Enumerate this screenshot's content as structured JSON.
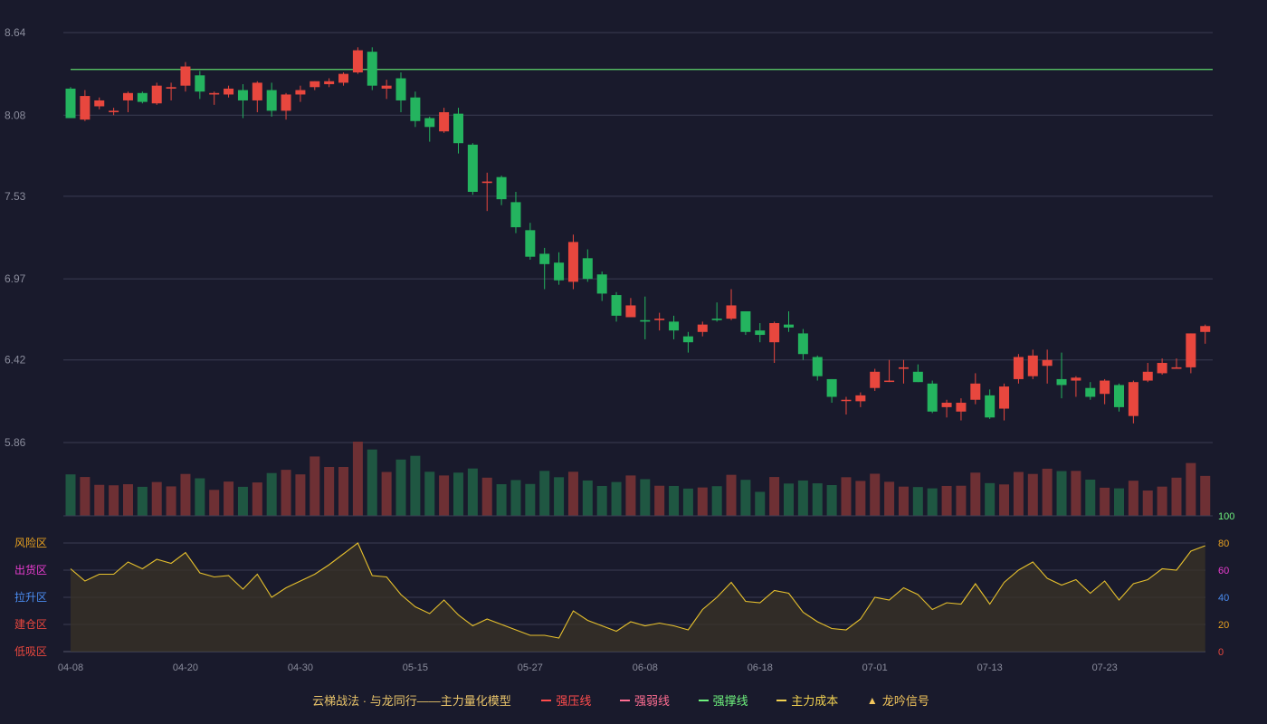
{
  "colors": {
    "background": "#191a2c",
    "up": "#e8473e",
    "down": "#24b45f",
    "vol_up": "#6e3034",
    "vol_down": "#1f5742",
    "pressure_line": "#5dd36a",
    "osc_line": "#e6c02d",
    "grid": "#3a3c52",
    "tick": "#8a8c9c"
  },
  "chart_data": {
    "type": "candlestick",
    "x_tick_labels": [
      "04-08",
      "04-20",
      "04-30",
      "05-15",
      "05-27",
      "06-08",
      "06-18",
      "07-01",
      "07-13",
      "07-23"
    ],
    "x_tick_indices": [
      0,
      8,
      16,
      24,
      32,
      40,
      48,
      56,
      64,
      72
    ],
    "price_axis": {
      "ticks": [
        "8.64",
        "8.08",
        "7.53",
        "6.97",
        "6.42",
        "5.86"
      ],
      "range": [
        5.86,
        8.64
      ]
    },
    "resistance_line": 8.39,
    "candles": [
      [
        8.26,
        8.06,
        8.27,
        8.06
      ],
      [
        8.05,
        8.21,
        8.25,
        8.04
      ],
      [
        8.14,
        8.18,
        8.2,
        8.12
      ],
      [
        8.1,
        8.11,
        8.13,
        8.08
      ],
      [
        8.18,
        8.23,
        8.24,
        8.1
      ],
      [
        8.23,
        8.17,
        8.24,
        8.16
      ],
      [
        8.16,
        8.28,
        8.3,
        8.15
      ],
      [
        8.26,
        8.27,
        8.3,
        8.18
      ],
      [
        8.28,
        8.41,
        8.44,
        8.24
      ],
      [
        8.35,
        8.24,
        8.38,
        8.19
      ],
      [
        8.22,
        8.23,
        8.24,
        8.15
      ],
      [
        8.22,
        8.26,
        8.28,
        8.2
      ],
      [
        8.25,
        8.18,
        8.29,
        8.06
      ],
      [
        8.18,
        8.3,
        8.31,
        8.1
      ],
      [
        8.25,
        8.11,
        8.3,
        8.07
      ],
      [
        8.11,
        8.22,
        8.23,
        8.05
      ],
      [
        8.22,
        8.25,
        8.28,
        8.17
      ],
      [
        8.27,
        8.31,
        8.31,
        8.25
      ],
      [
        8.29,
        8.31,
        8.33,
        8.27
      ],
      [
        8.3,
        8.36,
        8.37,
        8.28
      ],
      [
        8.37,
        8.52,
        8.54,
        8.36
      ],
      [
        8.51,
        8.28,
        8.54,
        8.25
      ],
      [
        8.26,
        8.28,
        8.32,
        8.19
      ],
      [
        8.33,
        8.18,
        8.37,
        8.1
      ],
      [
        8.2,
        8.04,
        8.24,
        8.0
      ],
      [
        8.06,
        8.0,
        8.07,
        7.9
      ],
      [
        7.97,
        8.1,
        8.13,
        7.96
      ],
      [
        8.09,
        7.89,
        8.13,
        7.82
      ],
      [
        7.88,
        7.56,
        7.89,
        7.54
      ],
      [
        7.62,
        7.63,
        7.69,
        7.43
      ],
      [
        7.66,
        7.51,
        7.67,
        7.47
      ],
      [
        7.49,
        7.32,
        7.56,
        7.28
      ],
      [
        7.3,
        7.12,
        7.35,
        7.1
      ],
      [
        7.14,
        7.07,
        7.18,
        6.9
      ],
      [
        7.08,
        6.96,
        7.15,
        6.93
      ],
      [
        6.95,
        7.22,
        7.27,
        6.9
      ],
      [
        7.11,
        6.97,
        7.17,
        6.95
      ],
      [
        7.0,
        6.87,
        7.02,
        6.82
      ],
      [
        6.86,
        6.72,
        6.88,
        6.68
      ],
      [
        6.71,
        6.79,
        6.84,
        6.71
      ],
      [
        6.69,
        6.68,
        6.85,
        6.56
      ],
      [
        6.69,
        6.7,
        6.74,
        6.62
      ],
      [
        6.68,
        6.62,
        6.72,
        6.56
      ],
      [
        6.58,
        6.54,
        6.61,
        6.47
      ],
      [
        6.61,
        6.66,
        6.68,
        6.58
      ],
      [
        6.7,
        6.69,
        6.81,
        6.68
      ],
      [
        6.7,
        6.79,
        6.9,
        6.69
      ],
      [
        6.75,
        6.61,
        6.75,
        6.59
      ],
      [
        6.62,
        6.59,
        6.67,
        6.54
      ],
      [
        6.54,
        6.67,
        6.68,
        6.4
      ],
      [
        6.66,
        6.64,
        6.75,
        6.61
      ],
      [
        6.6,
        6.46,
        6.63,
        6.42
      ],
      [
        6.44,
        6.31,
        6.45,
        6.28
      ],
      [
        6.29,
        6.17,
        6.29,
        6.13
      ],
      [
        6.15,
        6.15,
        6.17,
        6.05
      ],
      [
        6.14,
        6.18,
        6.2,
        6.1
      ],
      [
        6.23,
        6.34,
        6.36,
        6.21
      ],
      [
        6.28,
        6.28,
        6.42,
        6.27
      ],
      [
        6.36,
        6.37,
        6.42,
        6.26
      ],
      [
        6.34,
        6.27,
        6.39,
        6.27
      ],
      [
        6.26,
        6.07,
        6.28,
        6.06
      ],
      [
        6.1,
        6.13,
        6.15,
        6.03
      ],
      [
        6.07,
        6.13,
        6.16,
        6.01
      ],
      [
        6.15,
        6.26,
        6.33,
        6.12
      ],
      [
        6.18,
        6.03,
        6.22,
        6.02
      ],
      [
        6.09,
        6.24,
        6.26,
        6.01
      ],
      [
        6.29,
        6.44,
        6.46,
        6.26
      ],
      [
        6.31,
        6.45,
        6.49,
        6.29
      ],
      [
        6.38,
        6.42,
        6.49,
        6.26
      ],
      [
        6.29,
        6.25,
        6.47,
        6.16
      ],
      [
        6.28,
        6.3,
        6.31,
        6.17
      ],
      [
        6.23,
        6.17,
        6.27,
        6.15
      ],
      [
        6.19,
        6.28,
        6.29,
        6.12
      ],
      [
        6.25,
        6.1,
        6.26,
        6.07
      ],
      [
        6.04,
        6.27,
        6.28,
        5.99
      ],
      [
        6.28,
        6.34,
        6.4,
        6.27
      ],
      [
        6.33,
        6.4,
        6.43,
        6.32
      ],
      [
        6.36,
        6.37,
        6.43,
        6.36
      ],
      [
        6.37,
        6.6,
        6.6,
        6.33
      ],
      [
        6.61,
        6.65,
        6.66,
        6.53
      ]
    ],
    "volume": [
      1.9,
      1.78,
      1.42,
      1.4,
      1.45,
      1.33,
      1.55,
      1.35,
      1.92,
      1.72,
      1.19,
      1.57,
      1.33,
      1.53,
      1.96,
      2.11,
      1.9,
      2.72,
      2.24,
      2.24,
      3.4,
      3.04,
      2.01,
      2.58,
      2.75,
      2.02,
      1.85,
      1.98,
      2.17,
      1.75,
      1.45,
      1.64,
      1.46,
      2.06,
      1.77,
      2.02,
      1.62,
      1.37,
      1.55,
      1.85,
      1.68,
      1.38,
      1.37,
      1.25,
      1.3,
      1.36,
      1.88,
      1.65,
      1.1,
      1.78,
      1.48,
      1.62,
      1.49,
      1.41,
      1.77,
      1.6,
      1.93,
      1.56,
      1.34,
      1.32,
      1.26,
      1.37,
      1.38,
      1.98,
      1.5,
      1.44,
      2.01,
      1.92,
      2.16,
      2.05,
      2.06,
      1.66,
      1.29,
      1.26,
      1.61,
      1.16,
      1.34,
      1.75,
      2.42,
      1.83
    ],
    "oscillator": {
      "y_ticks": [
        "0",
        "20",
        "40",
        "60",
        "80",
        "100"
      ],
      "zones": [
        "低吸区",
        "建仓区",
        "拉升区",
        "出货区",
        "风险区"
      ],
      "values": [
        61,
        52,
        57,
        57,
        66,
        61,
        68,
        65,
        73,
        58,
        55,
        56,
        46,
        57,
        40,
        47,
        52,
        57,
        64,
        72,
        80,
        56,
        55,
        42,
        33,
        28,
        38,
        27,
        19,
        24,
        20,
        16,
        12,
        12,
        10,
        30,
        23,
        19,
        15,
        22,
        19,
        21,
        19,
        16,
        31,
        40,
        51,
        37,
        36,
        45,
        43,
        29,
        22,
        17,
        16,
        24,
        40,
        38,
        47,
        42,
        31,
        36,
        35,
        50,
        35,
        51,
        60,
        66,
        54,
        49,
        53,
        43,
        52,
        38,
        50,
        53,
        61,
        60,
        74,
        78
      ]
    }
  },
  "legend": {
    "title": "云梯战法 · 与龙同行——主力量化模型",
    "items": [
      {
        "label": "强压线",
        "color": "#ff4c4c",
        "style": "solid"
      },
      {
        "label": "强弱线",
        "color": "#ff6e92",
        "style": "dashed"
      },
      {
        "label": "强撑线",
        "color": "#6ef27d",
        "style": "solid"
      },
      {
        "label": "主力成本",
        "color": "#f0d050",
        "style": "dashed"
      }
    ],
    "signal": {
      "label": "龙吟信号",
      "symbol": "▲",
      "color": "#f2c55c"
    }
  }
}
